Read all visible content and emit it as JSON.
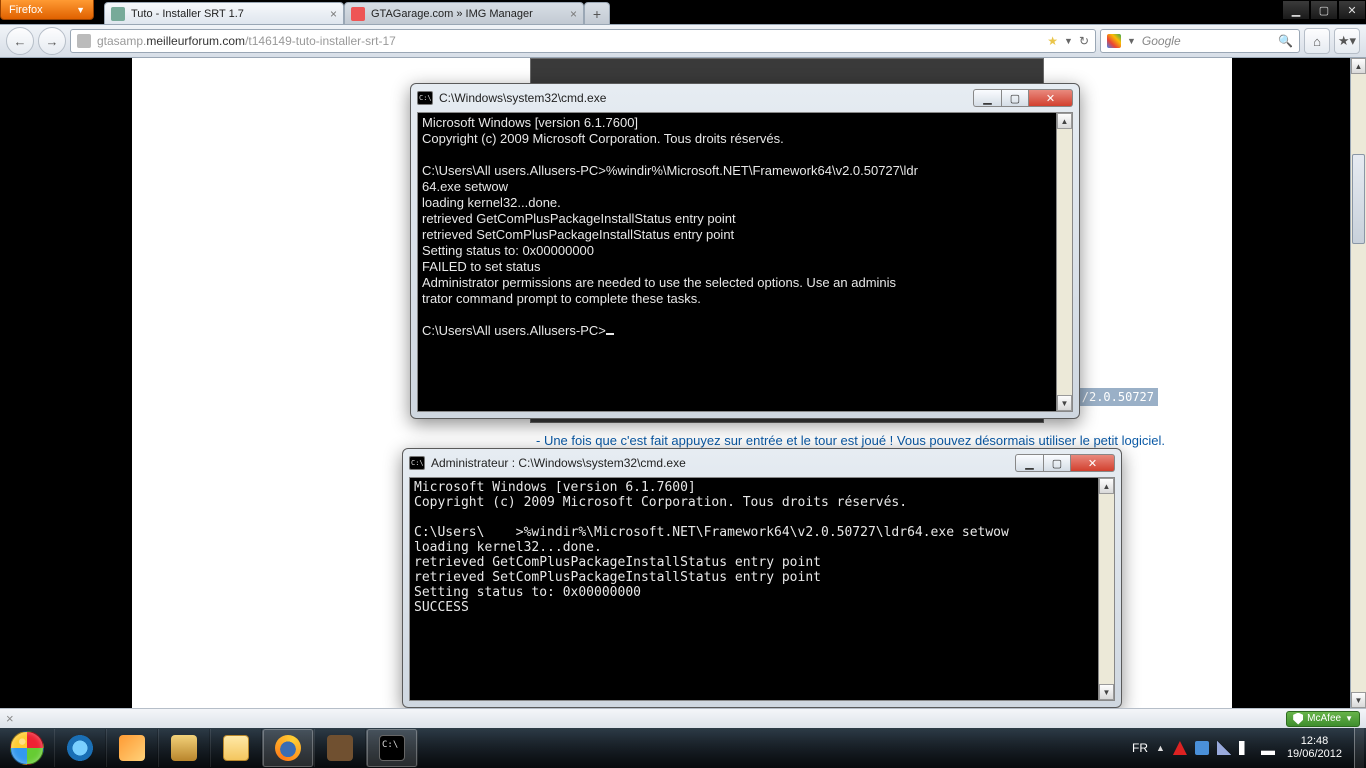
{
  "firefox_button": "Firefox",
  "tabs": [
    {
      "title": "Tuto - Installer SRT 1.7"
    },
    {
      "title": "GTAGarage.com » IMG Manager"
    }
  ],
  "url": {
    "dim_prefix": "gtasamp.",
    "host": "meilleurforum.com",
    "dim_suffix": "/t146149-tuto-installer-srt-17"
  },
  "search_placeholder": "Google",
  "page": {
    "path_hint": "/2.0.50727",
    "instruction": "- Une fois que c'est fait appuyez sur entrée et le tour est joué ! Vous pouvez désormais utiliser le petit logiciel."
  },
  "cmd1": {
    "title": "C:\\Windows\\system32\\cmd.exe",
    "body": "Microsoft Windows [version 6.1.7600]\nCopyright (c) 2009 Microsoft Corporation. Tous droits réservés.\n\nC:\\Users\\All users.Allusers-PC>%windir%\\Microsoft.NET\\Framework64\\v2.0.50727\\ldr\n64.exe setwow\nloading kernel32...done.\nretrieved GetComPlusPackageInstallStatus entry point\nretrieved SetComPlusPackageInstallStatus entry point\nSetting status to: 0x00000000\nFAILED to set status\nAdministrator permissions are needed to use the selected options. Use an adminis\ntrator command prompt to complete these tasks.\n\nC:\\Users\\All users.Allusers-PC>"
  },
  "cmd2": {
    "title": "Administrateur : C:\\Windows\\system32\\cmd.exe",
    "body": "Microsoft Windows [version 6.1.7600]\nCopyright (c) 2009 Microsoft Corporation. Tous droits réservés.\n\nC:\\Users\\    >%windir%\\Microsoft.NET\\Framework64\\v2.0.50727\\ldr64.exe setwow\nloading kernel32...done.\nretrieved GetComPlusPackageInstallStatus entry point\nretrieved SetComPlusPackageInstallStatus entry point\nSetting status to: 0x00000000\nSUCCESS"
  },
  "mcafee": "McAfee",
  "tray": {
    "lang": "FR",
    "time": "12:48",
    "date": "19/06/2012"
  }
}
